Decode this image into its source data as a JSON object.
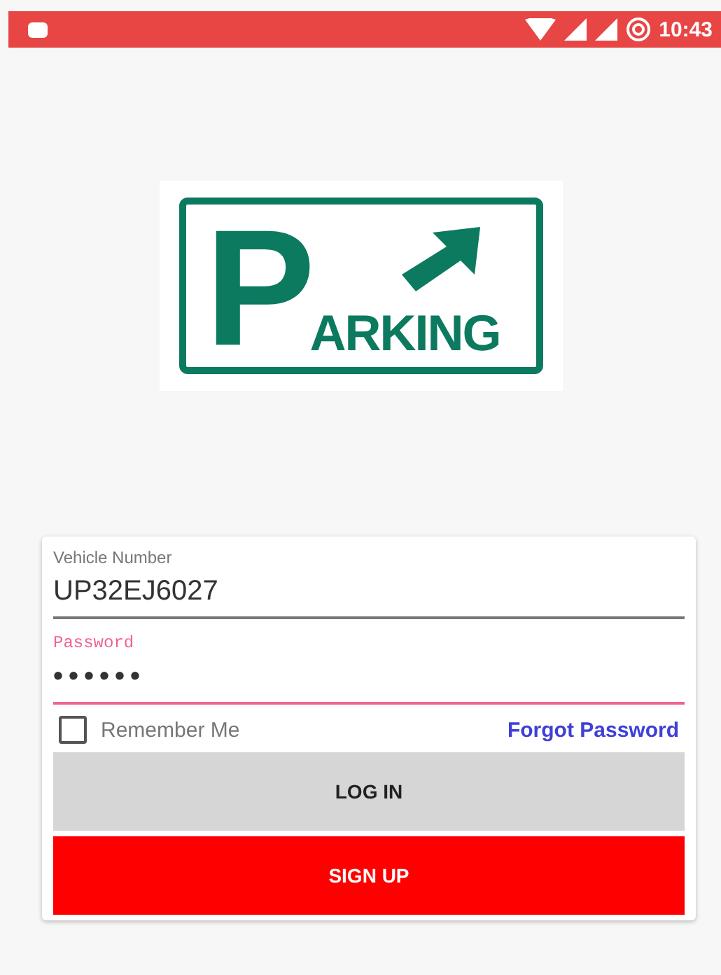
{
  "status_bar": {
    "time": "10:43"
  },
  "logo": {
    "big_letter": "P",
    "word_rest": "ARKING"
  },
  "form": {
    "fields": [
      {
        "label": "Vehicle Number",
        "value": "UP32EJ6027",
        "focused": false
      },
      {
        "label": "Password",
        "value": "••••••",
        "focused": true
      }
    ],
    "remember": {
      "label": "Remember Me",
      "checked": false
    },
    "forgot_link": "Forgot Password",
    "buttons": [
      {
        "label": "LOG IN",
        "kind": "secondary"
      },
      {
        "label": "SIGN UP",
        "kind": "primary"
      }
    ]
  }
}
